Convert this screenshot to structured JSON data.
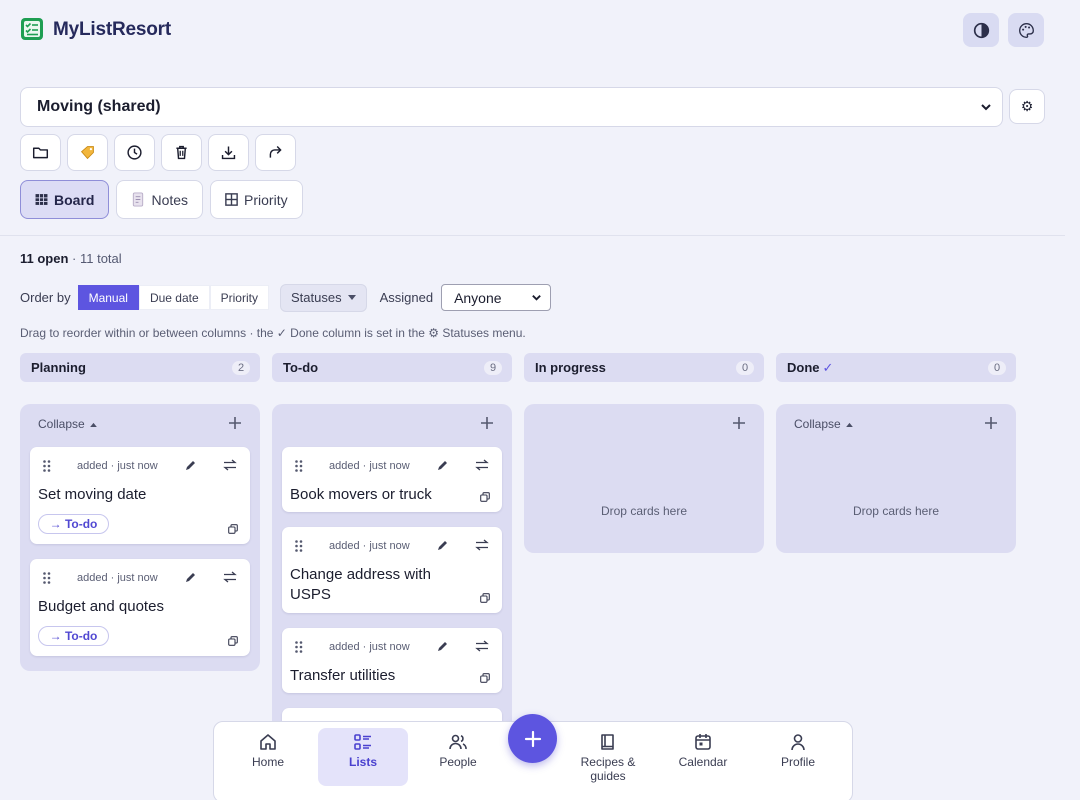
{
  "app": {
    "title": "MyListResort"
  },
  "list_selector": {
    "value": "Moving (shared)",
    "settings_glyph": "⚙"
  },
  "toolbar": {
    "icons": [
      "folder-icon",
      "tag-icon",
      "clock-icon",
      "trash-icon",
      "download-icon",
      "share-icon"
    ]
  },
  "view_tabs": [
    {
      "label": "Board",
      "icon": "board-icon",
      "active": true
    },
    {
      "label": "Notes",
      "icon": "notes-icon",
      "active": false
    },
    {
      "label": "Priority",
      "icon": "grid-icon",
      "active": false
    }
  ],
  "summary": {
    "open": "11 open",
    "total": "· 11 total"
  },
  "order": {
    "label": "Order by",
    "options": [
      {
        "label": "Manual",
        "active": true
      },
      {
        "label": "Due date",
        "active": false
      },
      {
        "label": "Priority",
        "active": false
      }
    ],
    "statuses_label": "Statuses",
    "assigned_label": "Assigned",
    "assigned_value": "Anyone"
  },
  "hint": "Drag to reorder within or between columns · the ✓ Done column is set in the ⚙ Statuses menu.",
  "columns": [
    {
      "name": "Planning",
      "check": "",
      "count": "2",
      "collapse_label": "Collapse",
      "drop_text": ""
    },
    {
      "name": "To-do",
      "check": "",
      "count": "9",
      "collapse_label": "",
      "drop_text": ""
    },
    {
      "name": "In progress",
      "check": "",
      "count": "0",
      "collapse_label": "",
      "drop_text": "Drop cards here"
    },
    {
      "name": "Done",
      "check": "✓",
      "count": "0",
      "collapse_label": "Collapse",
      "drop_text": "Drop cards here"
    }
  ],
  "cards": {
    "planning": [
      {
        "meta": "added · just now",
        "title": "Set moving date",
        "status": "→ To-do"
      },
      {
        "meta": "added · just now",
        "title": "Budget and quotes",
        "status": "→ To-do"
      }
    ],
    "todo": [
      {
        "meta": "added · just now",
        "title": "Book movers or truck"
      },
      {
        "meta": "added · just now",
        "title": "Change address with USPS"
      },
      {
        "meta": "added · just now",
        "title": "Transfer utilities"
      }
    ]
  },
  "bottom_nav": [
    {
      "label": "Home",
      "icon": "home-icon",
      "active": false
    },
    {
      "label": "Lists",
      "icon": "lists-icon",
      "active": true
    },
    {
      "label": "People",
      "icon": "people-icon",
      "active": false
    },
    {
      "label": "Recipes & guides",
      "icon": "book-icon",
      "active": false
    },
    {
      "label": "Calendar",
      "icon": "calendar-icon",
      "active": false
    },
    {
      "label": "Profile",
      "icon": "profile-icon",
      "active": false
    }
  ],
  "colors": {
    "accent": "#5d55e0",
    "column_bg": "#dcdcf2",
    "page_bg": "#f1f2fa"
  }
}
